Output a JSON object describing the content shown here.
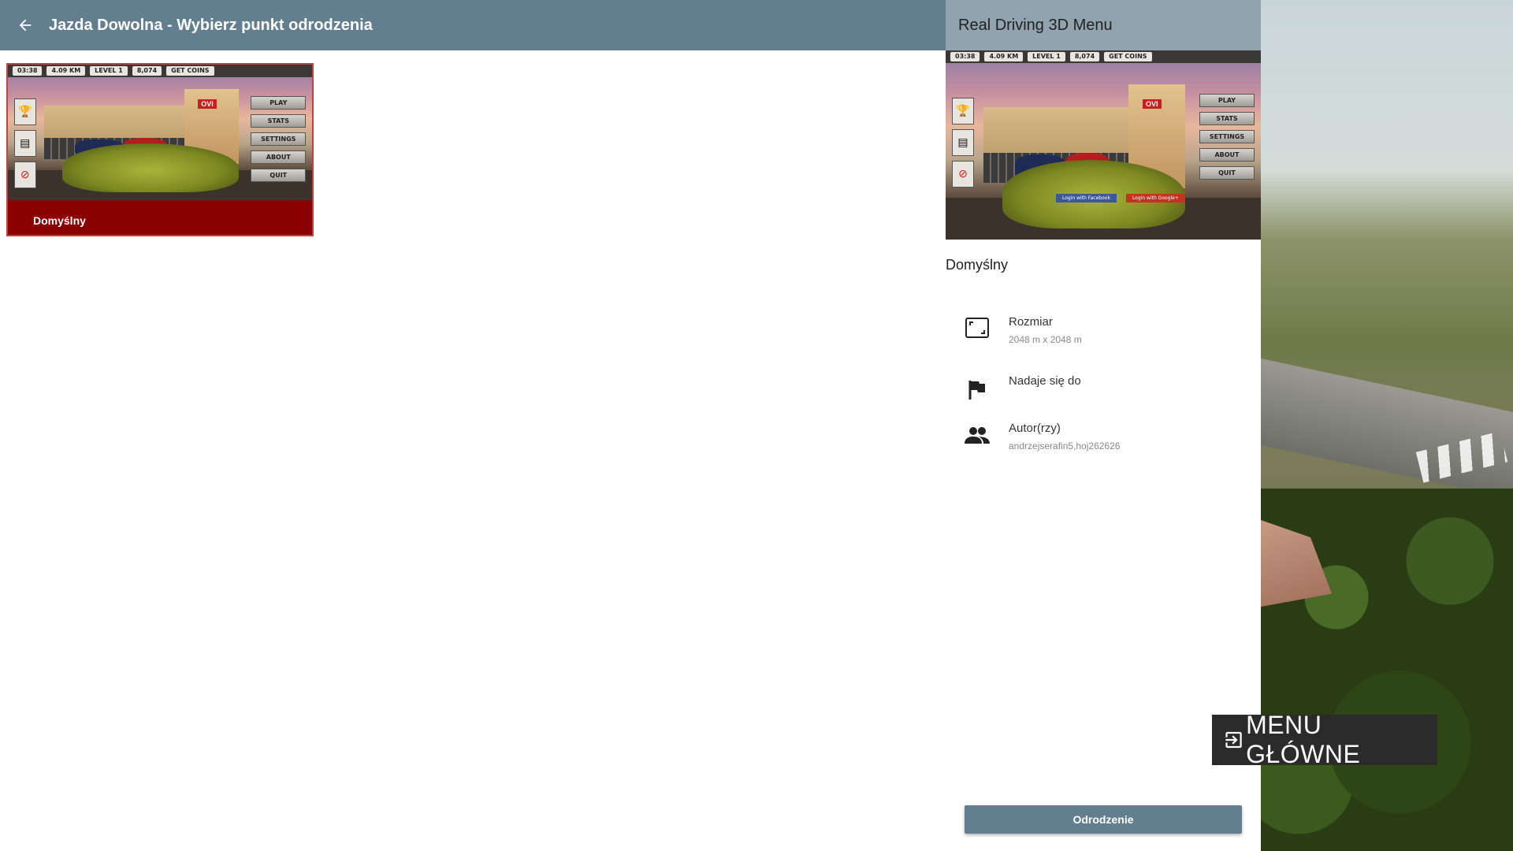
{
  "header": {
    "title": "Jazda Dowolna - Wybierz punkt odrodzenia",
    "back_icon": "arrow-left-icon"
  },
  "map_list": [
    {
      "label": "Domyślny",
      "selected": true
    }
  ],
  "screenshot": {
    "hud": [
      "03:38",
      "4.09 KM",
      "LEVEL 1",
      "8,074",
      "GET COINS"
    ],
    "menu_buttons": [
      "PLAY",
      "STATS",
      "SETTINGS",
      "ABOUT",
      "QUIT"
    ],
    "login_buttons": [
      "Login with Facebook",
      "Login with Google+"
    ]
  },
  "panel": {
    "title": "Real Driving 3D Menu",
    "map_name": "Domyślny",
    "details": [
      {
        "icon": "aspect-ratio-icon",
        "title": "Rozmiar",
        "value": "2048 m x 2048 m"
      },
      {
        "icon": "flag-icon",
        "title": "Nadaje się do",
        "value": ""
      },
      {
        "icon": "people-icon",
        "title": "Autor(rzy)",
        "value": "andrzejserafin5,hoj262626"
      }
    ],
    "spawn_button": "Odrodzenie"
  },
  "overlay": {
    "main_menu_label": "MENU GŁÓWNE",
    "main_menu_icon": "exit-to-app-icon"
  },
  "colors": {
    "topbar": "#637f8f",
    "panel_header": "#90a3ae",
    "selected_card": "#8b0000",
    "spawn_button": "#637f8f"
  }
}
